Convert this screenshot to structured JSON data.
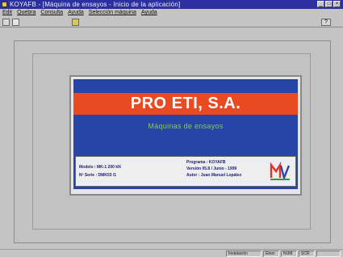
{
  "titlebar": {
    "title": "KOYAFB - [Máquina de ensayos - Inicio de la aplicación]",
    "minimize_glyph": "_",
    "maximize_glyph": "□",
    "close_glyph": "×"
  },
  "menu": {
    "items": [
      "Edit",
      "Quebra",
      "Consulta",
      "Ayuda",
      "Selección máquina",
      "Ayuda"
    ]
  },
  "toolbar": {
    "help_glyph": "?"
  },
  "splash": {
    "company": "PRO ETI, S.A.",
    "subtitle": "Máquinas de ensayos",
    "model_line": "Modelo : MK-1 200 kN",
    "serial_line": "Nº Serie : DMK03 /1",
    "program_line": "Programa : KOYAFB",
    "version_line": "Versión 05.8 / Junio - 1999",
    "author_line": "Autor : Juan Manuel Lopátez"
  },
  "statusbar": {
    "panel1": "Instalación",
    "panel2": "Ebox",
    "panel3": "NUM",
    "panel4": "SCR",
    "panel5": ""
  },
  "colors": {
    "title_blue": "#2b2f9f",
    "splash_blue": "#2744a8",
    "splash_red": "#ea4a22",
    "subtitle_green": "#7fcf5b"
  }
}
